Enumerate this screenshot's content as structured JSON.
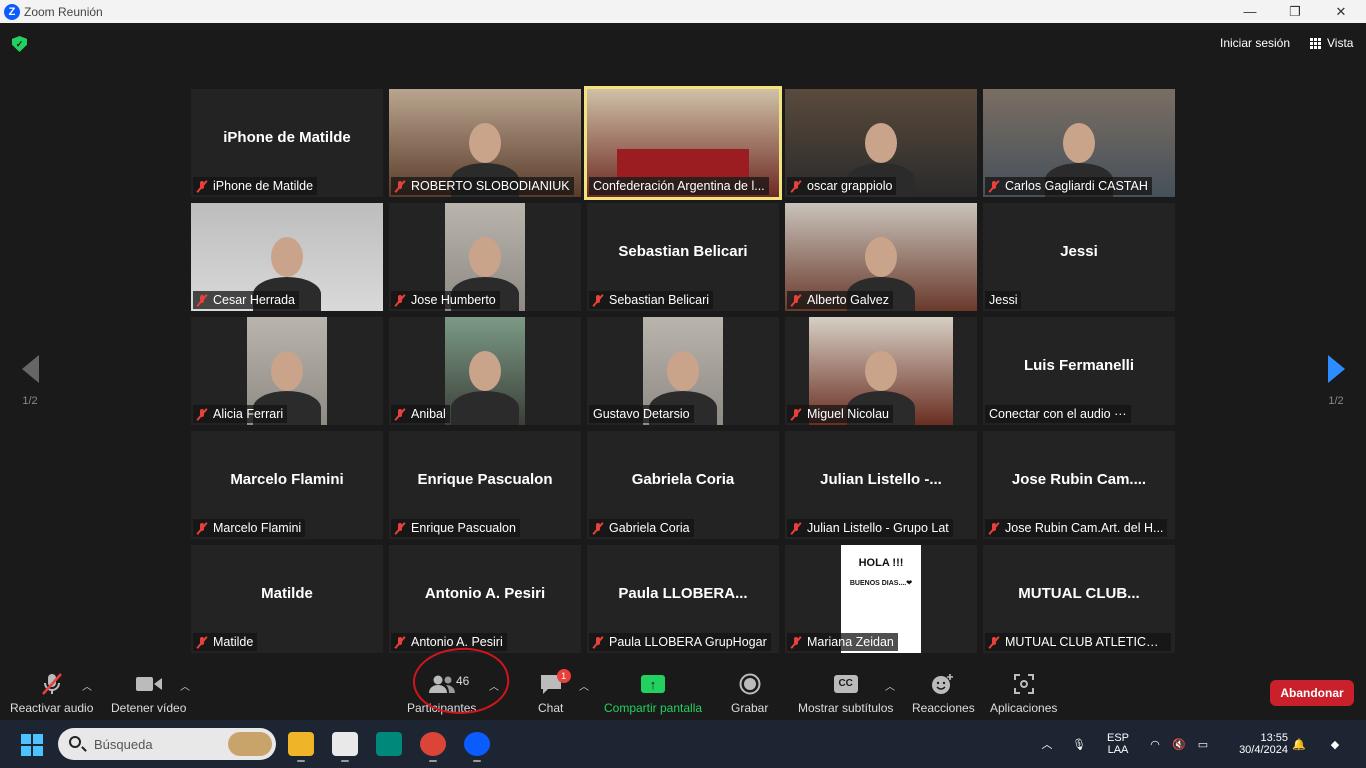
{
  "window": {
    "title": "Zoom Reunión",
    "minimize": "—",
    "maximize": "❐",
    "close": "✕"
  },
  "topbar": {
    "signin": "Iniciar sesión",
    "view": "Vista"
  },
  "nav": {
    "prev_page": "1/2",
    "next_page": "1/2"
  },
  "tiles": [
    {
      "big": "iPhone de Matilde",
      "label": "iPhone de Matilde",
      "muted": true,
      "video": false
    },
    {
      "big": "",
      "label": "ROBERTO SLOBODIANIUK",
      "muted": true,
      "video": true,
      "palette": "office"
    },
    {
      "big": "",
      "label": "Confederación Argentina de l...",
      "muted": false,
      "video": true,
      "active": true,
      "palette": "conference"
    },
    {
      "big": "",
      "label": "oscar grappiolo",
      "muted": true,
      "video": true,
      "palette": "dark"
    },
    {
      "big": "",
      "label": "Carlos  Gagliardi CASTAH",
      "muted": true,
      "video": true,
      "palette": "room"
    },
    {
      "big": "",
      "label": "Cesar Herrada",
      "muted": true,
      "video": true,
      "palette": "white"
    },
    {
      "big": "",
      "label": "Jose Humberto",
      "muted": true,
      "video": true,
      "palette": "portrait"
    },
    {
      "big": "Sebastian Belicari",
      "label": "Sebastian Belicari",
      "muted": true,
      "video": false
    },
    {
      "big": "",
      "label": "Alberto Galvez",
      "muted": true,
      "video": true,
      "palette": "brick"
    },
    {
      "big": "Jessi",
      "label": "Jessi",
      "muted": false,
      "video": false
    },
    {
      "big": "",
      "label": "Alicia Ferrari",
      "muted": true,
      "video": true,
      "palette": "portrait"
    },
    {
      "big": "",
      "label": "Anibal",
      "muted": true,
      "video": true,
      "palette": "car"
    },
    {
      "big": "",
      "label": "Gustavo Detarsio",
      "muted": false,
      "video": true,
      "palette": "portrait"
    },
    {
      "big": "",
      "label": "Miguel Nicolau",
      "muted": true,
      "video": true,
      "palette": "wide"
    },
    {
      "big": "Luis Fermanelli",
      "label": "Conectar con el audio ···",
      "muted": false,
      "video": false
    },
    {
      "big": "Marcelo Flamini",
      "label": "Marcelo Flamini",
      "muted": true,
      "video": false
    },
    {
      "big": "Enrique Pascualon",
      "label": "Enrique Pascualon",
      "muted": true,
      "video": false
    },
    {
      "big": "Gabriela Coria",
      "label": "Gabriela Coria",
      "muted": true,
      "video": false
    },
    {
      "big": "Julian  Listello -...",
      "label": "Julian Listello - Grupo Lat",
      "muted": true,
      "video": false
    },
    {
      "big": "Jose  Rubin  Cam....",
      "label": "Jose Rubin Cam.Art. del H...",
      "muted": true,
      "video": false
    },
    {
      "big": "Matilde",
      "label": "Matilde",
      "muted": true,
      "video": false
    },
    {
      "big": "Antonio  A.  Pesiri",
      "label": "Antonio A. Pesiri",
      "muted": true,
      "video": false
    },
    {
      "big": "Paula  LLOBERA...",
      "label": "Paula LLOBERA GrupHogar",
      "muted": true,
      "video": false
    },
    {
      "big": "",
      "label": "Mariana Zeidan",
      "muted": true,
      "video": true,
      "palette": "card",
      "card_text": "HOLA !!!",
      "card_sub": "BUENOS DIAS....❤"
    },
    {
      "big": "MUTUAL  CLUB...",
      "label": "MUTUAL CLUB ATLETICO PI...",
      "muted": true,
      "video": false
    }
  ],
  "toolbar": {
    "unmute": "Reactivar audio",
    "stop_video": "Detener vídeo",
    "participants": "Participantes",
    "participant_count": "46",
    "chat": "Chat",
    "chat_badge": "1",
    "share": "Compartir pantalla",
    "record": "Grabar",
    "captions": "Mostrar subtítulos",
    "captions_icon_text": "CC",
    "reactions": "Reacciones",
    "apps": "Aplicaciones",
    "leave": "Abandonar"
  },
  "taskbar": {
    "search_placeholder": "Búsqueda",
    "lang_top": "ESP",
    "lang_bottom": "LAA",
    "time": "13:55",
    "date": "30/4/2024"
  },
  "colors": {
    "accent_blue": "#2d8cff",
    "share_green": "#23d160",
    "leave_red": "#c9202c",
    "active_speaker": "#f2e37c",
    "muted_red": "#e8403a"
  }
}
